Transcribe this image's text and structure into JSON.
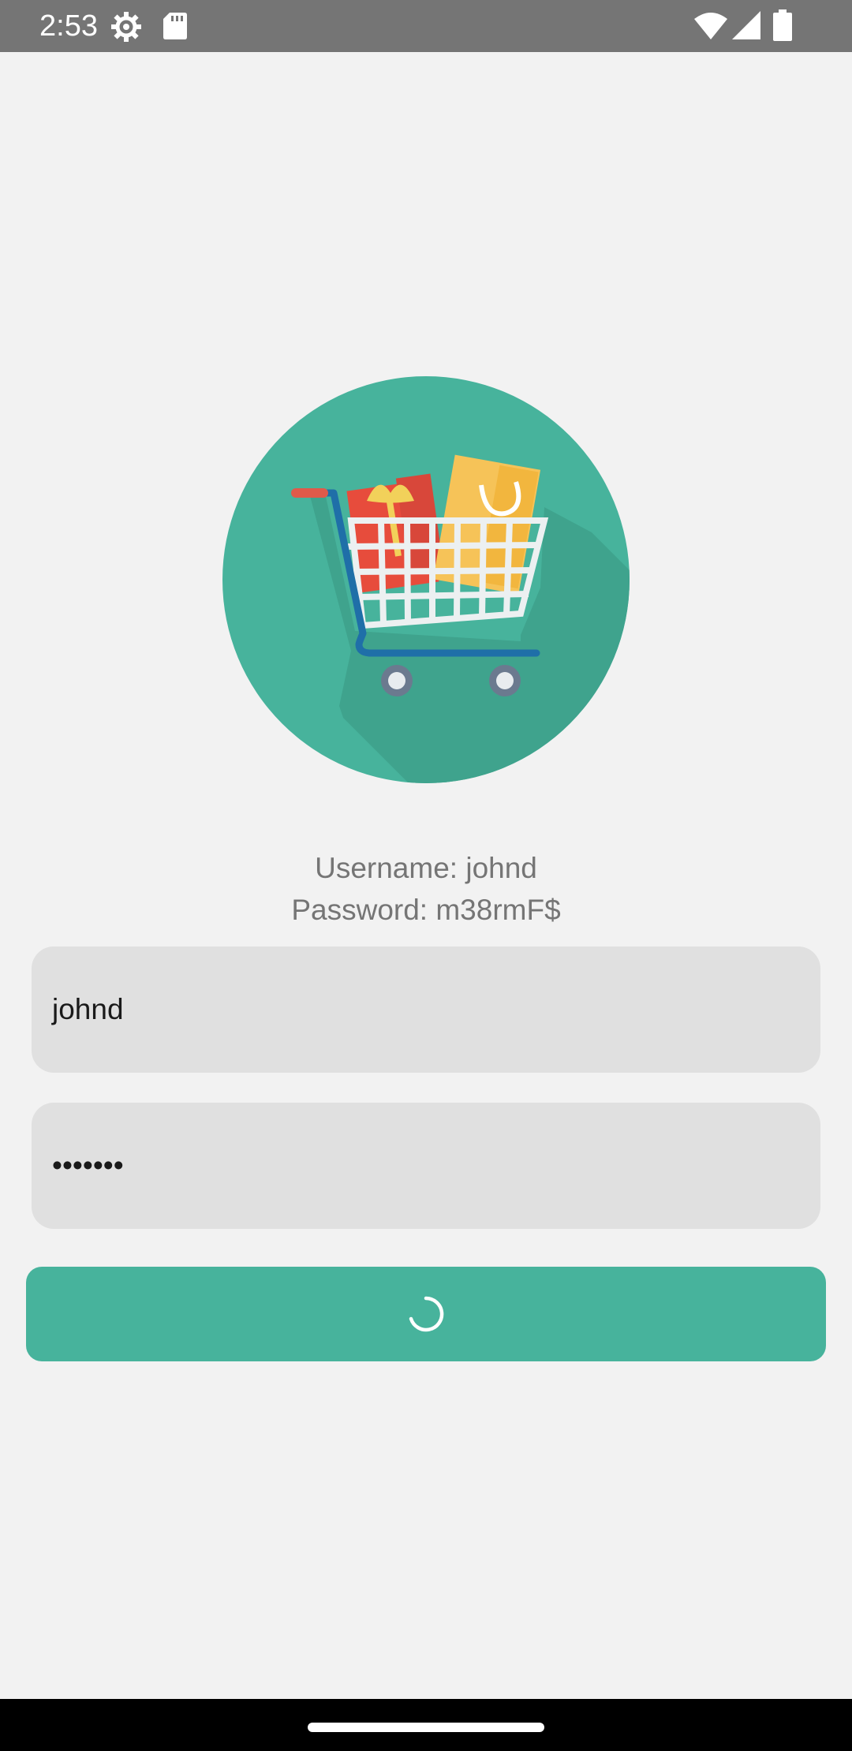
{
  "status_bar": {
    "time": "2:53",
    "icons": [
      "settings-gear-icon",
      "sd-card-icon",
      "wifi-icon",
      "cellular-signal-icon",
      "battery-icon"
    ]
  },
  "logo": {
    "icon": "shopping-cart-icon",
    "colors": {
      "circle": "#47b39c",
      "shadow": "#3fa38d",
      "cart_frame": "#1f6fa8",
      "basket": "#ecf0f1",
      "gift_box": "#e74c3c",
      "ribbon": "#f2d15a",
      "bag": "#f6c358",
      "wheel": "#6b7a8f"
    }
  },
  "credentials_hint": {
    "username_line": "Username: johnd",
    "password_line": "Password: m38rmF$"
  },
  "form": {
    "username_value": "johnd",
    "password_value": "•••••••"
  },
  "login_button": {
    "state": "loading",
    "icon": "loading-spinner-icon",
    "color": "#47b39c"
  },
  "nav_bar": {
    "icon": "home-gesture-pill"
  }
}
